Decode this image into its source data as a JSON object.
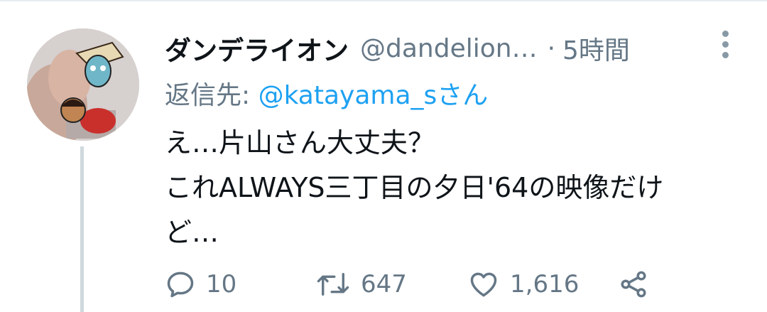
{
  "tweet": {
    "display_name": "ダンデライオン",
    "handle": "@dandelion…",
    "separator": "·",
    "time": "5時間",
    "reply_label": "返信先:",
    "reply_to": "@katayama_sさん",
    "text_lines": [
      "え…片山さん大丈夫？",
      "これALWAYS三丁目の夕日'64の映像だけ",
      "ど…"
    ],
    "counts": {
      "replies": "10",
      "retweets": "647",
      "likes": "1,616"
    }
  },
  "icons": [
    "avatar-photo",
    "more-vert-icon",
    "reply-icon",
    "retweet-icon",
    "like-icon",
    "share-icon"
  ],
  "colors": {
    "text": "#0f1419",
    "secondary": "#657786",
    "link": "#1da1f2",
    "thread_line": "#cfd9de"
  }
}
